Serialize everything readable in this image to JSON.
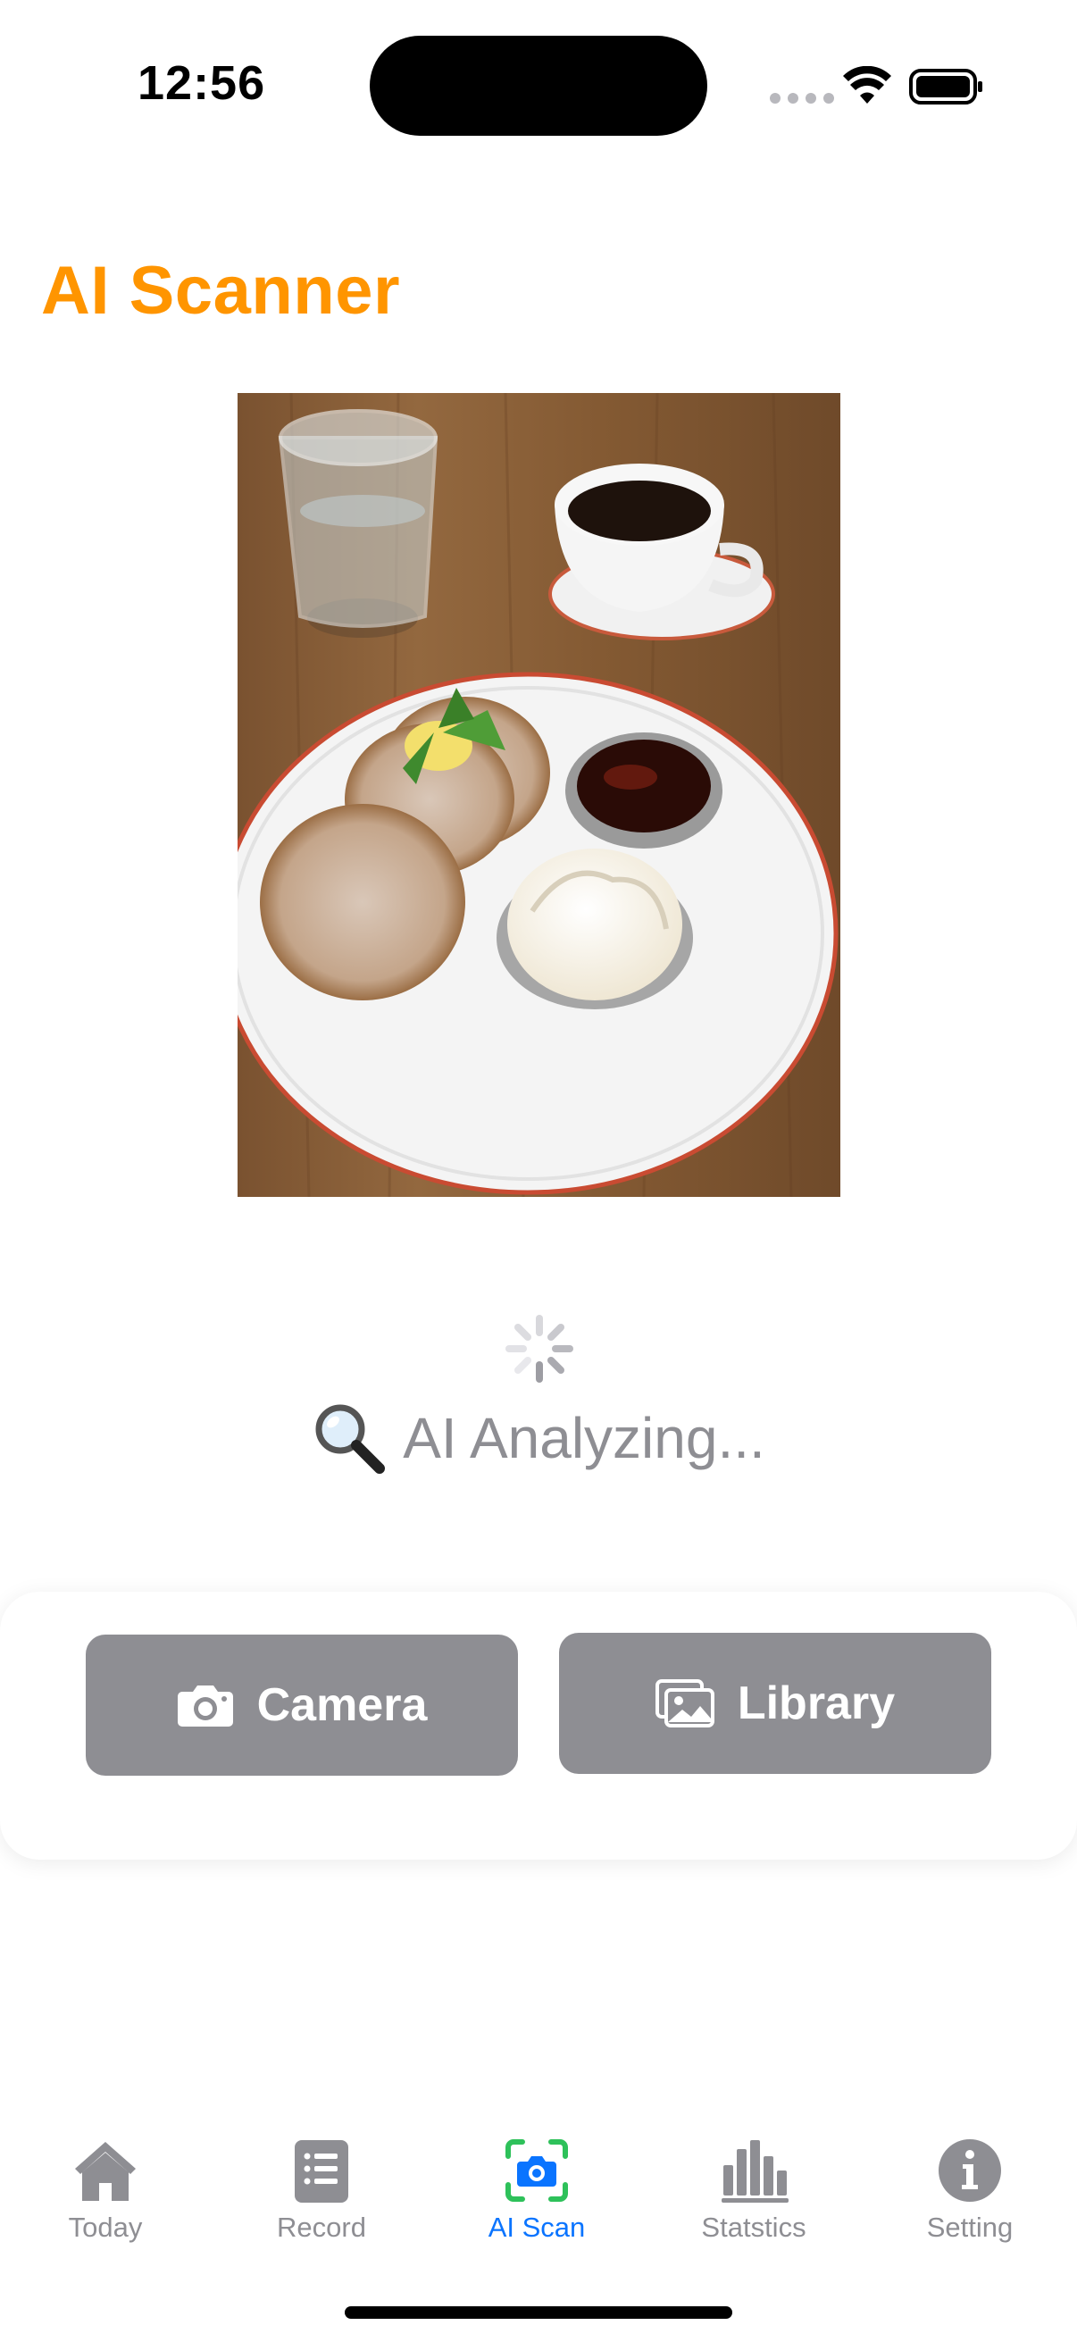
{
  "status_bar": {
    "time": "12:56"
  },
  "header": {
    "title": "AI Scanner"
  },
  "photo": {
    "subject": "pancakes-with-butter-cream-syrup-coffee-water"
  },
  "analysis": {
    "status_text": "AI Analyzing..."
  },
  "actions": {
    "camera_label": "Camera",
    "library_label": "Library"
  },
  "tab_bar": {
    "items": [
      {
        "label": "Today",
        "icon": "house-icon",
        "active": false
      },
      {
        "label": "Record",
        "icon": "list-icon",
        "active": false
      },
      {
        "label": "AI Scan",
        "icon": "camera-scan-icon",
        "active": true
      },
      {
        "label": "Statstics",
        "icon": "bar-chart-icon",
        "active": false
      },
      {
        "label": "Setting",
        "icon": "info-icon",
        "active": false
      }
    ]
  },
  "colors": {
    "accent": "#ff9500",
    "active_tab": "#0a74ff",
    "button_gray": "#8e8e93"
  }
}
